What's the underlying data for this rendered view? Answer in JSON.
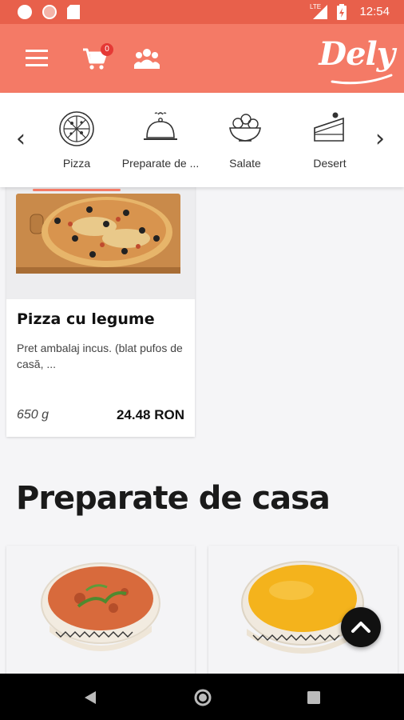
{
  "status_bar": {
    "time": "12:54",
    "network": "LTE"
  },
  "app_bar": {
    "logo": "Dely",
    "cart_count": "0",
    "icons": [
      "menu-icon",
      "cart-icon",
      "group-icon"
    ]
  },
  "categories": {
    "items": [
      {
        "label": "Pizza",
        "icon": "pizza-icon",
        "active": true
      },
      {
        "label": "Preparate de ...",
        "icon": "cloche-icon",
        "active": false
      },
      {
        "label": "Salate",
        "icon": "salad-bowl-icon",
        "active": false
      },
      {
        "label": "Desert",
        "icon": "cake-slice-icon",
        "active": false
      }
    ]
  },
  "products": [
    {
      "title": "Pizza cu legume",
      "description": "Pret ambalaj incus. (blat pufos de casă, ...",
      "weight": "650 g",
      "price": "24.48 RON"
    }
  ],
  "section": {
    "title": "Preparate de casa"
  },
  "colors": {
    "primary": "#f47a66",
    "status_bar": "#e8604b",
    "accent_underline": "#f47a66",
    "badge": "#e53935"
  }
}
